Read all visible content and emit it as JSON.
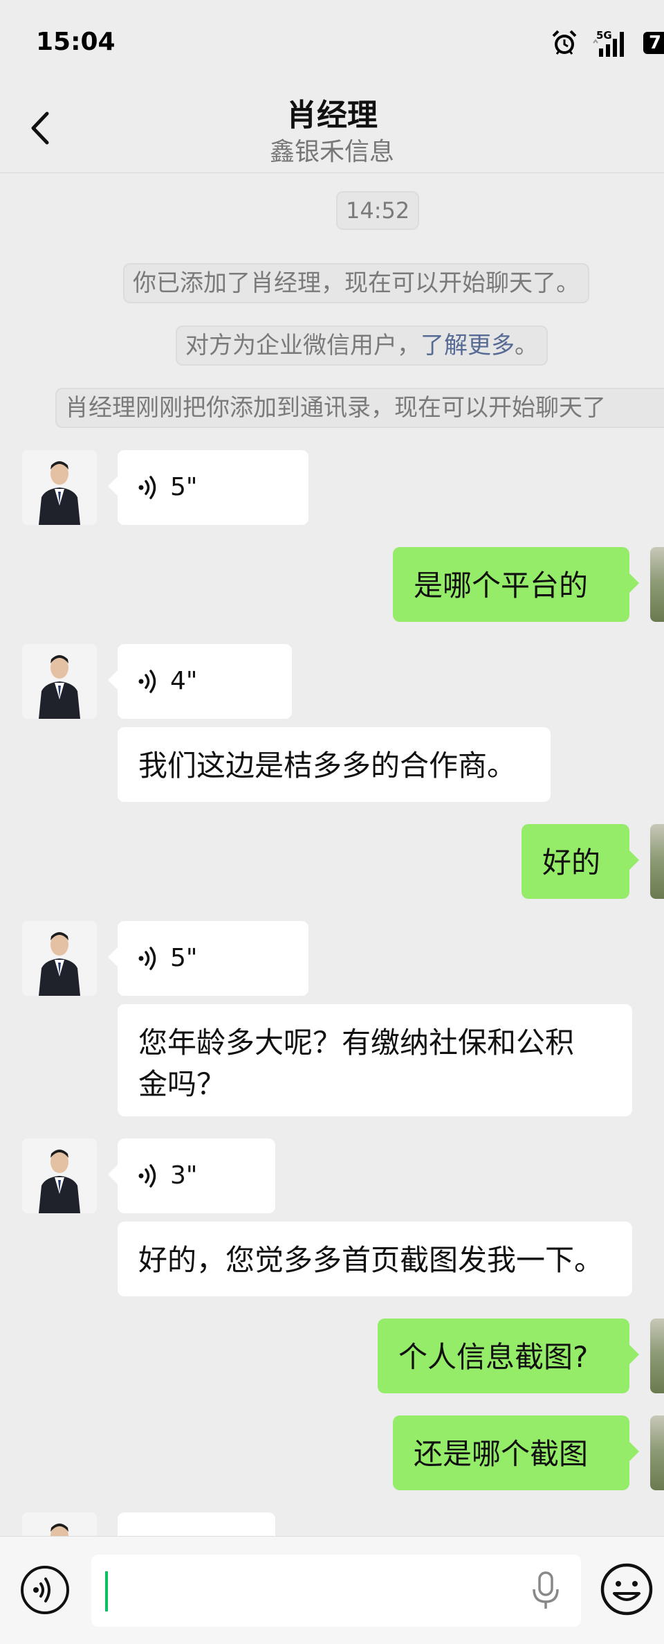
{
  "status_bar": {
    "time": "15:04",
    "network": "5G",
    "battery": "7"
  },
  "header": {
    "title": "肖经理",
    "subtitle": "鑫银禾信息"
  },
  "system": {
    "timestamp": "14:52",
    "added_notice": "你已添加了肖经理，现在可以开始聊天了。",
    "enterprise_notice_prefix": "对方为企业微信用户，",
    "enterprise_notice_link": "了解更多",
    "enterprise_notice_suffix": "。",
    "contact_notice": "肖经理刚刚把你添加到通讯录，现在可以开始聊天了"
  },
  "messages": [
    {
      "side": "in",
      "type": "voice",
      "duration": "5\""
    },
    {
      "side": "out",
      "type": "text",
      "text": "是哪个平台的"
    },
    {
      "side": "in",
      "type": "voice",
      "duration": "4\""
    },
    {
      "side": "in",
      "type": "text",
      "text": "我们这边是桔多多的合作商。"
    },
    {
      "side": "out",
      "type": "text",
      "text": "好的"
    },
    {
      "side": "in",
      "type": "voice",
      "duration": "5\""
    },
    {
      "side": "in",
      "type": "text",
      "text": "您年龄多大呢？有缴纳社保和公积\n金吗？"
    },
    {
      "side": "in",
      "type": "voice",
      "duration": "3\""
    },
    {
      "side": "in",
      "type": "text",
      "text": "好的，您觉多多首页截图发我一下。"
    },
    {
      "side": "out",
      "type": "text",
      "text": "个人信息截图?"
    },
    {
      "side": "out",
      "type": "text",
      "text": "还是哪个截图"
    }
  ],
  "input": {
    "value": "",
    "placeholder": ""
  },
  "colors": {
    "background": "#ededed",
    "bubble_in": "#ffffff",
    "bubble_out": "#95ec69",
    "link": "#576b95",
    "caret": "#07c160"
  },
  "icons": [
    "back-arrow-icon",
    "alarm-icon",
    "signal-icon",
    "battery-icon",
    "voice-wave-icon",
    "microphone-icon",
    "emoji-icon"
  ]
}
